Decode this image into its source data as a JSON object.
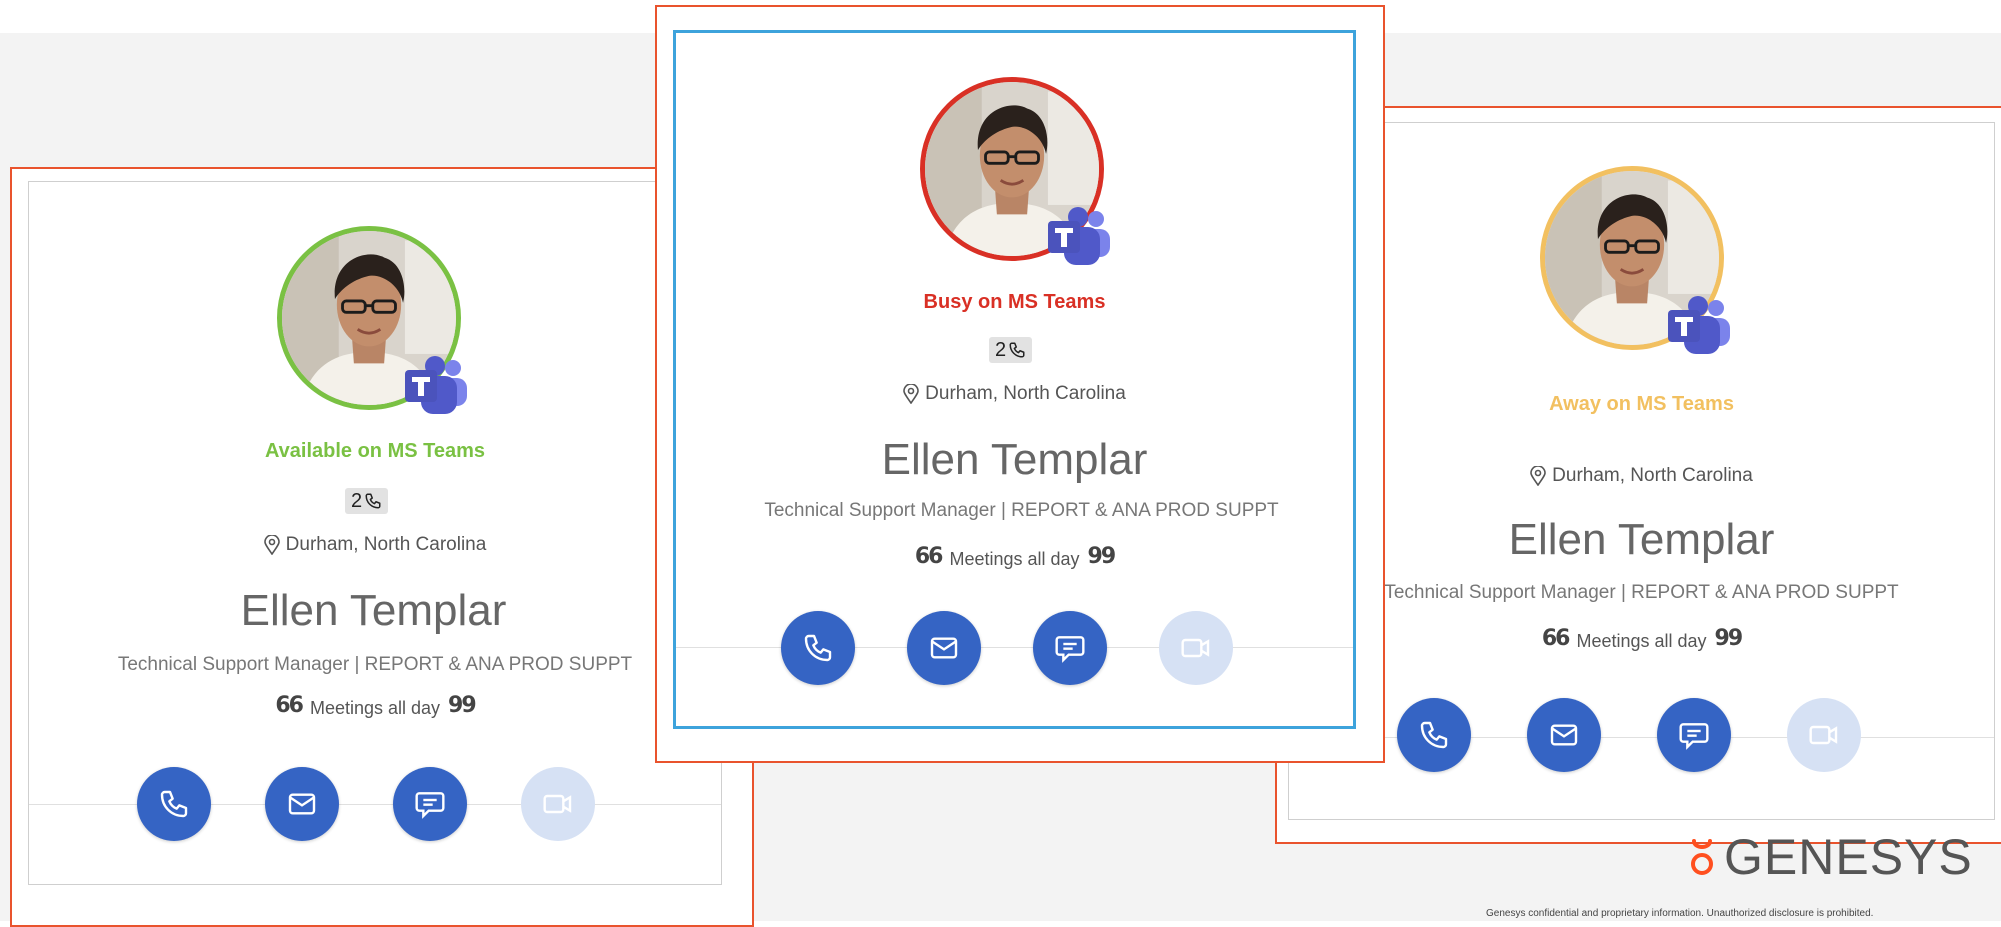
{
  "colors": {
    "frame": "#e9532d",
    "selected_border": "#3da3dc",
    "action_blue": "#3564c4",
    "action_disabled": "#d6e1f4",
    "available": "#7ac143",
    "busy": "#d93025",
    "away": "#f2c060"
  },
  "cards": [
    {
      "status_label": "Available on MS Teams",
      "status_color": "#7ac143",
      "calls_count": "2",
      "location": "Durham, North Carolina",
      "name": "Ellen Templar",
      "job_title": "Technical Support Manager | REPORT & ANA PROD SUPPT",
      "status_message": "Meetings all day",
      "actions": [
        "phone-icon",
        "mail-icon",
        "chat-icon",
        "video-icon"
      ]
    },
    {
      "status_label": "Busy on MS Teams",
      "status_color": "#d93025",
      "calls_count": "2",
      "location": "Durham, North Carolina",
      "name": "Ellen Templar",
      "job_title": "Technical Support Manager | REPORT & ANA PROD SUPPT",
      "status_message": "Meetings all day",
      "actions": [
        "phone-icon",
        "mail-icon",
        "chat-icon",
        "video-icon"
      ]
    },
    {
      "status_label": "Away on MS Teams",
      "status_color": "#f2c060",
      "location": "Durham, North Carolina",
      "name": "Ellen Templar",
      "job_title": "Technical Support Manager | REPORT & ANA PROD SUPPT",
      "status_message": "Meetings all day",
      "actions": [
        "phone-icon",
        "mail-icon",
        "chat-icon",
        "video-icon"
      ]
    }
  ],
  "brand": {
    "logo_text": "GENESYS",
    "footer": "Genesys confidential and proprietary information. Unauthorized disclosure is prohibited."
  }
}
